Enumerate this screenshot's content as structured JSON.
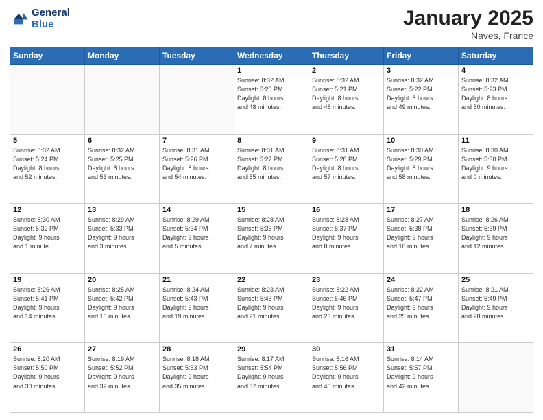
{
  "header": {
    "logo_line1": "General",
    "logo_line2": "Blue",
    "month": "January 2025",
    "location": "Naves, France"
  },
  "weekdays": [
    "Sunday",
    "Monday",
    "Tuesday",
    "Wednesday",
    "Thursday",
    "Friday",
    "Saturday"
  ],
  "weeks": [
    [
      {
        "day": "",
        "detail": ""
      },
      {
        "day": "",
        "detail": ""
      },
      {
        "day": "",
        "detail": ""
      },
      {
        "day": "1",
        "detail": "Sunrise: 8:32 AM\nSunset: 5:20 PM\nDaylight: 8 hours\nand 48 minutes."
      },
      {
        "day": "2",
        "detail": "Sunrise: 8:32 AM\nSunset: 5:21 PM\nDaylight: 8 hours\nand 48 minutes."
      },
      {
        "day": "3",
        "detail": "Sunrise: 8:32 AM\nSunset: 5:22 PM\nDaylight: 8 hours\nand 49 minutes."
      },
      {
        "day": "4",
        "detail": "Sunrise: 8:32 AM\nSunset: 5:23 PM\nDaylight: 8 hours\nand 50 minutes."
      }
    ],
    [
      {
        "day": "5",
        "detail": "Sunrise: 8:32 AM\nSunset: 5:24 PM\nDaylight: 8 hours\nand 52 minutes."
      },
      {
        "day": "6",
        "detail": "Sunrise: 8:32 AM\nSunset: 5:25 PM\nDaylight: 8 hours\nand 53 minutes."
      },
      {
        "day": "7",
        "detail": "Sunrise: 8:31 AM\nSunset: 5:26 PM\nDaylight: 8 hours\nand 54 minutes."
      },
      {
        "day": "8",
        "detail": "Sunrise: 8:31 AM\nSunset: 5:27 PM\nDaylight: 8 hours\nand 55 minutes."
      },
      {
        "day": "9",
        "detail": "Sunrise: 8:31 AM\nSunset: 5:28 PM\nDaylight: 8 hours\nand 57 minutes."
      },
      {
        "day": "10",
        "detail": "Sunrise: 8:30 AM\nSunset: 5:29 PM\nDaylight: 8 hours\nand 58 minutes."
      },
      {
        "day": "11",
        "detail": "Sunrise: 8:30 AM\nSunset: 5:30 PM\nDaylight: 9 hours\nand 0 minutes."
      }
    ],
    [
      {
        "day": "12",
        "detail": "Sunrise: 8:30 AM\nSunset: 5:32 PM\nDaylight: 9 hours\nand 1 minute."
      },
      {
        "day": "13",
        "detail": "Sunrise: 8:29 AM\nSunset: 5:33 PM\nDaylight: 9 hours\nand 3 minutes."
      },
      {
        "day": "14",
        "detail": "Sunrise: 8:29 AM\nSunset: 5:34 PM\nDaylight: 9 hours\nand 5 minutes."
      },
      {
        "day": "15",
        "detail": "Sunrise: 8:28 AM\nSunset: 5:35 PM\nDaylight: 9 hours\nand 7 minutes."
      },
      {
        "day": "16",
        "detail": "Sunrise: 8:28 AM\nSunset: 5:37 PM\nDaylight: 9 hours\nand 8 minutes."
      },
      {
        "day": "17",
        "detail": "Sunrise: 8:27 AM\nSunset: 5:38 PM\nDaylight: 9 hours\nand 10 minutes."
      },
      {
        "day": "18",
        "detail": "Sunrise: 8:26 AM\nSunset: 5:39 PM\nDaylight: 9 hours\nand 12 minutes."
      }
    ],
    [
      {
        "day": "19",
        "detail": "Sunrise: 8:26 AM\nSunset: 5:41 PM\nDaylight: 9 hours\nand 14 minutes."
      },
      {
        "day": "20",
        "detail": "Sunrise: 8:25 AM\nSunset: 5:42 PM\nDaylight: 9 hours\nand 16 minutes."
      },
      {
        "day": "21",
        "detail": "Sunrise: 8:24 AM\nSunset: 5:43 PM\nDaylight: 9 hours\nand 19 minutes."
      },
      {
        "day": "22",
        "detail": "Sunrise: 8:23 AM\nSunset: 5:45 PM\nDaylight: 9 hours\nand 21 minutes."
      },
      {
        "day": "23",
        "detail": "Sunrise: 8:22 AM\nSunset: 5:46 PM\nDaylight: 9 hours\nand 23 minutes."
      },
      {
        "day": "24",
        "detail": "Sunrise: 8:22 AM\nSunset: 5:47 PM\nDaylight: 9 hours\nand 25 minutes."
      },
      {
        "day": "25",
        "detail": "Sunrise: 8:21 AM\nSunset: 5:49 PM\nDaylight: 9 hours\nand 28 minutes."
      }
    ],
    [
      {
        "day": "26",
        "detail": "Sunrise: 8:20 AM\nSunset: 5:50 PM\nDaylight: 9 hours\nand 30 minutes."
      },
      {
        "day": "27",
        "detail": "Sunrise: 8:19 AM\nSunset: 5:52 PM\nDaylight: 9 hours\nand 32 minutes."
      },
      {
        "day": "28",
        "detail": "Sunrise: 8:18 AM\nSunset: 5:53 PM\nDaylight: 9 hours\nand 35 minutes."
      },
      {
        "day": "29",
        "detail": "Sunrise: 8:17 AM\nSunset: 5:54 PM\nDaylight: 9 hours\nand 37 minutes."
      },
      {
        "day": "30",
        "detail": "Sunrise: 8:16 AM\nSunset: 5:56 PM\nDaylight: 9 hours\nand 40 minutes."
      },
      {
        "day": "31",
        "detail": "Sunrise: 8:14 AM\nSunset: 5:57 PM\nDaylight: 9 hours\nand 42 minutes."
      },
      {
        "day": "",
        "detail": ""
      }
    ]
  ]
}
